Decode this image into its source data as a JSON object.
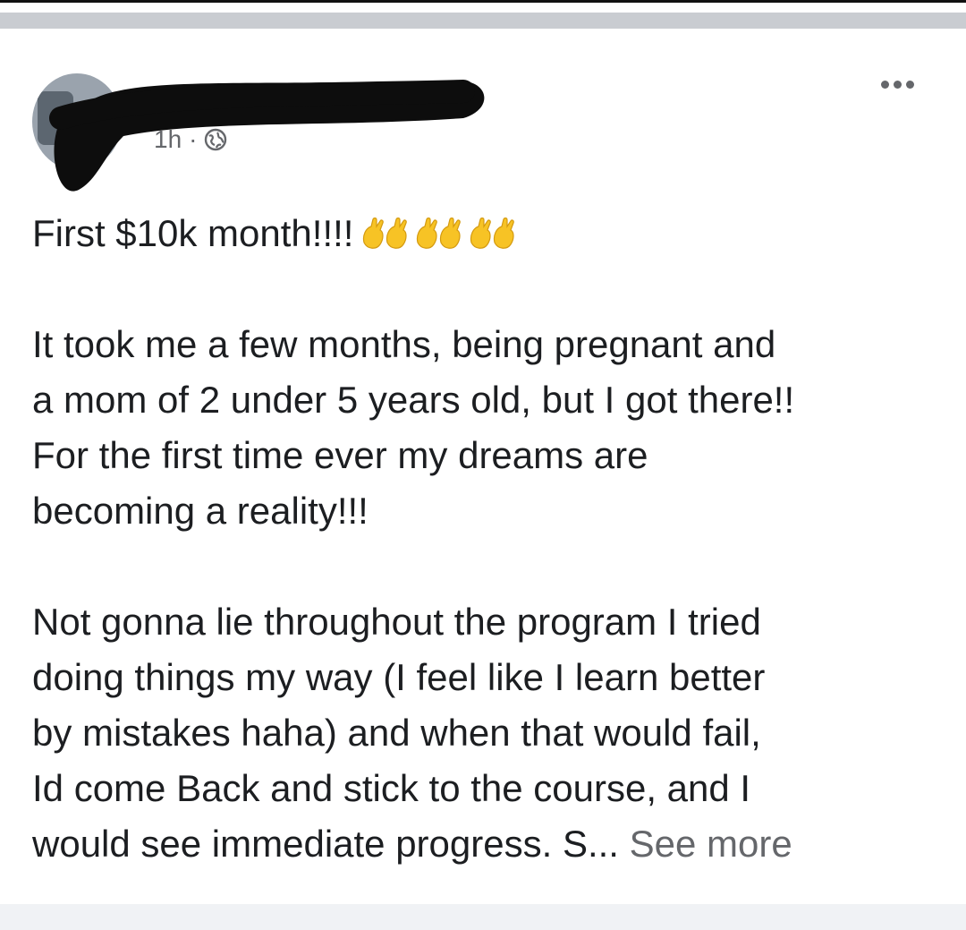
{
  "post": {
    "timestamp": "1h",
    "separator": "·",
    "audience_icon": "globe-icon",
    "more_icon": "more-dots-icon",
    "headline": "First $10k month!!!!",
    "headline_emoji_icon": "raising-hands-icon",
    "headline_emoji_count": 3,
    "paragraph_1_lines": [
      "It took me a few months, being pregnant and",
      "a mom of 2 under 5 years old, but I got there!!",
      "For the first time ever my dreams are",
      "becoming a reality!!!"
    ],
    "paragraph_2_lines": [
      "Not gonna lie throughout the program I tried",
      "doing things my way (I feel like I learn better",
      "by mistakes haha) and when that would fail,",
      "Id come Back and stick to the course, and I"
    ],
    "last_line": "would see immediate progress. S...",
    "see_more": "See more"
  },
  "colors": {
    "text": "#1c1e21",
    "secondary_text": "#65676b",
    "background": "#ffffff",
    "page_background": "#f0f2f5",
    "emoji_yellow": "#f7c325",
    "redaction": "#0d0d0d"
  }
}
